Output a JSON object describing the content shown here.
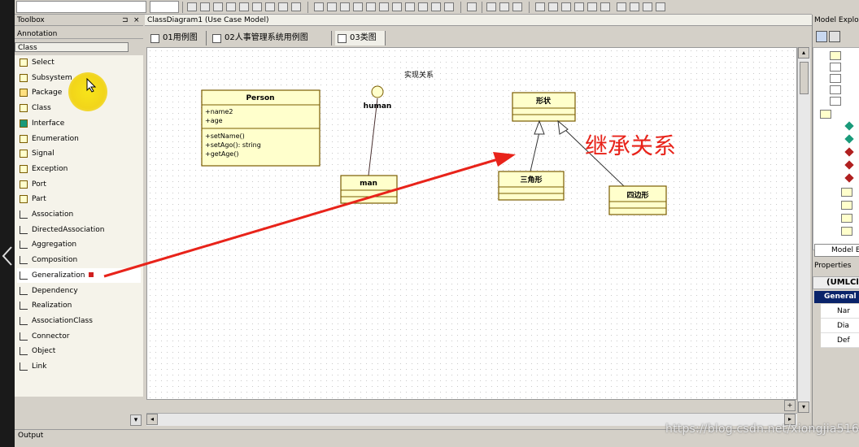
{
  "toolbox": {
    "title": "Toolbox",
    "section": "Annotation",
    "group": "Class",
    "items": [
      {
        "label": "Select",
        "icon": "pointer-icon"
      },
      {
        "label": "Subsystem",
        "icon": "subsystem-icon"
      },
      {
        "label": "Package",
        "icon": "package-icon"
      },
      {
        "label": "Class",
        "icon": "class-icon"
      },
      {
        "label": "Interface",
        "icon": "interface-icon"
      },
      {
        "label": "Enumeration",
        "icon": "enumeration-icon"
      },
      {
        "label": "Signal",
        "icon": "signal-icon"
      },
      {
        "label": "Exception",
        "icon": "exception-icon"
      },
      {
        "label": "Port",
        "icon": "port-icon"
      },
      {
        "label": "Part",
        "icon": "part-icon"
      },
      {
        "label": "Association",
        "icon": "association-icon"
      },
      {
        "label": "DirectedAssociation",
        "icon": "directed-association-icon"
      },
      {
        "label": "Aggregation",
        "icon": "aggregation-icon"
      },
      {
        "label": "Composition",
        "icon": "composition-icon"
      },
      {
        "label": "Generalization",
        "icon": "generalization-icon"
      },
      {
        "label": "Dependency",
        "icon": "dependency-icon"
      },
      {
        "label": "Realization",
        "icon": "realization-icon"
      },
      {
        "label": "AssociationClass",
        "icon": "association-class-icon"
      },
      {
        "label": "Connector",
        "icon": "connector-icon"
      },
      {
        "label": "Object",
        "icon": "object-icon"
      },
      {
        "label": "Link",
        "icon": "link-icon"
      }
    ],
    "selected_index": 14
  },
  "diagram": {
    "window_title": "ClassDiagram1 (Use Case Model)",
    "tabs": [
      "01用例图",
      "02人事管理系统用例图",
      "03类图"
    ],
    "canvas": {
      "realization_label": "实现关系",
      "person": {
        "name": "Person",
        "attributes": [
          "+name2",
          "+age"
        ],
        "operations": [
          "+setName()",
          "+setAgo(): string",
          "+getAge()"
        ]
      },
      "human_label": "human",
      "man_label": "man",
      "shape_label": "形状",
      "triangle_label": "三角形",
      "quad_label": "四边形",
      "inheritance_annotation": "继承关系"
    }
  },
  "right_panel": {
    "model_explorer_title": "Model Explorer",
    "model_explorer_tab": "Model Ex",
    "properties_title": "Properties",
    "properties_header": "(UMLClass",
    "general_label": "General",
    "property_rows": [
      "Nar",
      "Dia",
      "Def"
    ]
  },
  "output": {
    "title": "Output"
  },
  "watermark": "https://blog.csdn.net/xiongjia516",
  "colors": {
    "uml_fill": "#ffffcc",
    "uml_border": "#7a5c00",
    "arrow": "#e8231a",
    "selection": "#0a246a",
    "highlight": "#f3dc17"
  }
}
